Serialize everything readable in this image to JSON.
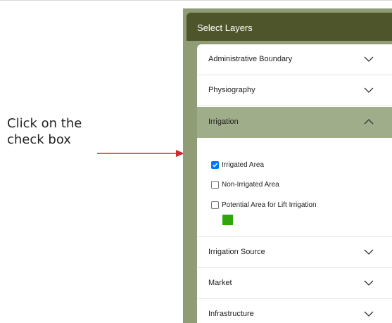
{
  "annotation": {
    "line1": "Click on the",
    "line2": "check box",
    "arrow_color": "#d62828"
  },
  "panel": {
    "title": "Select Layers",
    "header_color": "#4f552b",
    "active_row_color": "#9fad8a",
    "sections": [
      {
        "label": "Administrative Boundary",
        "expanded": false
      },
      {
        "label": "Physiography",
        "expanded": false
      },
      {
        "label": "Irrigation",
        "expanded": true
      },
      {
        "label": "Irrigation Source",
        "expanded": false
      },
      {
        "label": "Market",
        "expanded": false
      },
      {
        "label": "Infrastructure",
        "expanded": false
      }
    ],
    "irrigation_layers": [
      {
        "label": "Irrigated Area",
        "checked": true
      },
      {
        "label": "Non-Irrigated Area",
        "checked": false
      },
      {
        "label": "Potential Area for Lift Irrigation",
        "checked": false
      }
    ],
    "legend_color": "#2fa60a",
    "icons": {
      "collapsed": "chevron-down-icon",
      "expanded": "chevron-up-icon",
      "checked": "checkmark-icon"
    }
  }
}
